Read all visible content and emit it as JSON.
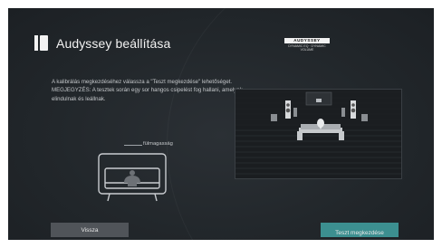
{
  "header": {
    "title": "Audyssey beállítása",
    "icon": "speaker-icon"
  },
  "logo": {
    "top_text": "AUDYSSEY",
    "bottom_text": "DYNAMIC EQ · DYNAMIC VOLUME"
  },
  "instructions": {
    "text": "A kalibrálás megkezdéséhez válassza a \"Teszt megkezdése\" lehetőséget. MEGJEGYZÉS: A tesztek során egy sor hangos csipelést fog hallani, amelyek elindulnak és leállnak."
  },
  "diagram": {
    "ear_height_label": "fülmagasság"
  },
  "buttons": {
    "back_label": "Vissza",
    "start_label": "Teszt megkezdése"
  },
  "colors": {
    "accent": "#3c8f90",
    "button_secondary": "#505459",
    "background": "#22272b"
  }
}
